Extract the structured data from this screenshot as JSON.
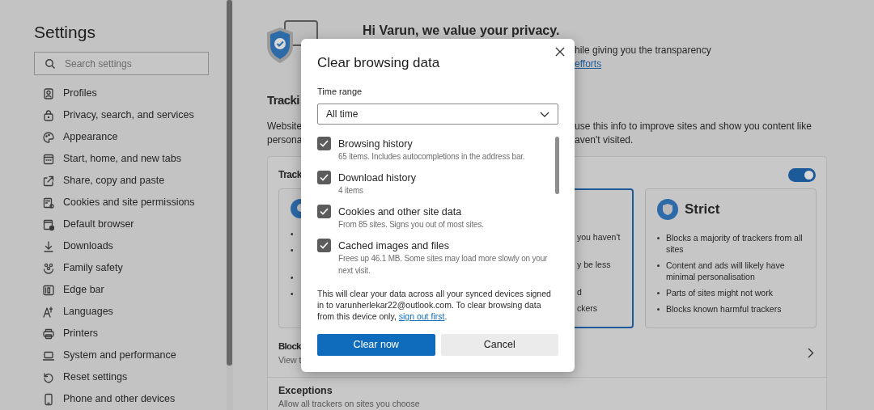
{
  "sidebar": {
    "title": "Settings",
    "search": {
      "placeholder": "Search settings"
    },
    "items": [
      {
        "label": "Profiles"
      },
      {
        "label": "Privacy, search, and services"
      },
      {
        "label": "Appearance"
      },
      {
        "label": "Start, home, and new tabs"
      },
      {
        "label": "Share, copy and paste"
      },
      {
        "label": "Cookies and site permissions"
      },
      {
        "label": "Default browser"
      },
      {
        "label": "Downloads"
      },
      {
        "label": "Family safety"
      },
      {
        "label": "Edge bar"
      },
      {
        "label": "Languages"
      },
      {
        "label": "Printers"
      },
      {
        "label": "System and performance"
      },
      {
        "label": "Reset settings"
      },
      {
        "label": "Phone and other devices"
      }
    ]
  },
  "privacy_header": {
    "title": "Hi Varun, we value your privacy.",
    "text": "hile giving you the transparency",
    "link": "efforts"
  },
  "tracking": {
    "heading": "Tracki",
    "description_left": [
      "Website",
      "persona"
    ],
    "description_right": [
      "use this info to improve sites and show you content like",
      "aven't visited."
    ],
    "card": {
      "title": "Track",
      "toggle_on": true,
      "levels": [
        {
          "kind": "cut_right",
          "selected": false,
          "lines": [
            "•",
            "•",
            "•",
            "•"
          ]
        },
        {
          "kind": "cut_left",
          "selected": true,
          "lines": [
            "you haven't",
            "y be less",
            "d",
            "ckers"
          ]
        },
        {
          "kind": "full",
          "selected": false,
          "title": "Strict",
          "bullets": [
            "Blocks a majority of trackers from all sites",
            "Content and ads will likely have minimal personalisation",
            "Parts of sites might not work",
            "Blocks known harmful trackers"
          ]
        }
      ],
      "block": {
        "title": "Block",
        "subtitle": "View t"
      },
      "exceptions": {
        "title": "Exceptions",
        "subtitle": "Allow all trackers on sites you choose"
      }
    }
  },
  "dialog": {
    "title": "Clear browsing data",
    "time_range": {
      "label": "Time range",
      "value": "All time"
    },
    "options": [
      {
        "label": "Browsing history",
        "detail": "65 items. Includes autocompletions in the address bar.",
        "checked": true
      },
      {
        "label": "Download history",
        "detail": "4 items",
        "checked": true
      },
      {
        "label": "Cookies and other site data",
        "detail": "From 85 sites. Signs you out of most sites.",
        "checked": true
      },
      {
        "label": "Cached images and files",
        "detail": "Frees up 46.1 MB. Some sites may load more slowly on your next visit.",
        "checked": true
      }
    ],
    "notice": "This will clear your data across all your synced devices signed in to varunherlekar22@outlook.com. To clear browsing data from this device only,",
    "notice_link": "sign out first",
    "notice_end": ".",
    "buttons": [
      {
        "label": "Clear now",
        "kind": "primary"
      },
      {
        "label": "Cancel",
        "kind": "secondary"
      }
    ]
  }
}
